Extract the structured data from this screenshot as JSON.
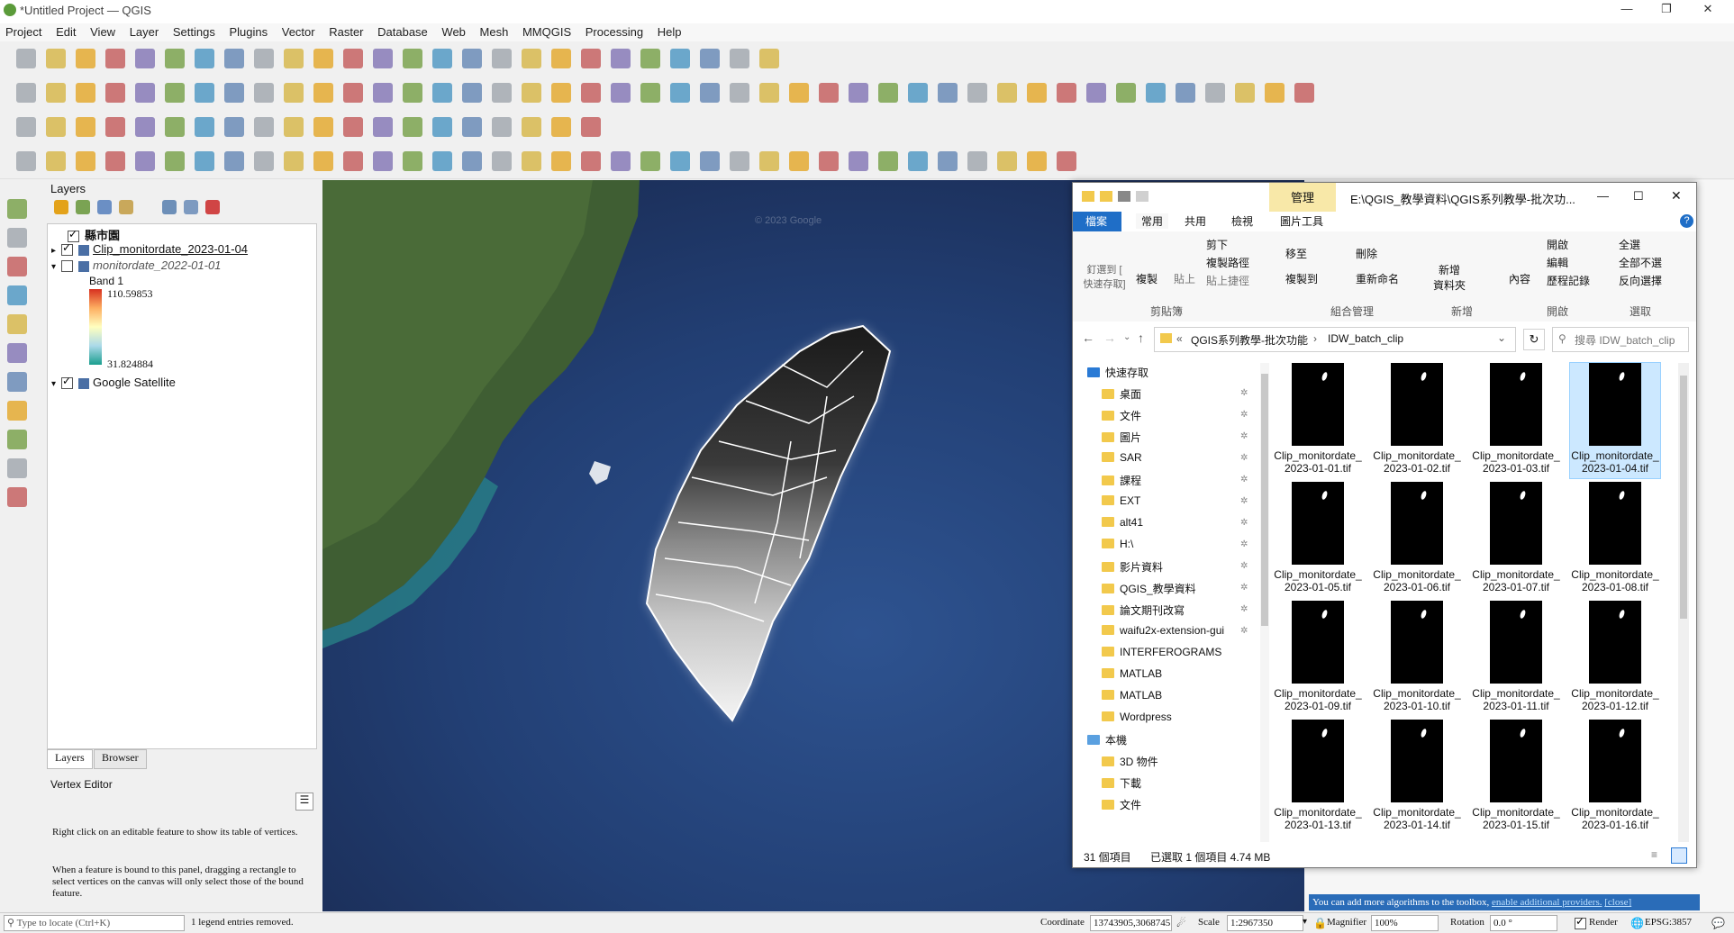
{
  "window": {
    "title": "*Untitled Project — QGIS"
  },
  "menu": [
    "Project",
    "Edit",
    "View",
    "Layer",
    "Settings",
    "Plugins",
    "Vector",
    "Raster",
    "Database",
    "Web",
    "Mesh",
    "MMQGIS",
    "Processing",
    "Help"
  ],
  "layers_panel": {
    "title": "Layers",
    "items": [
      {
        "label": "縣市園",
        "checked": true
      },
      {
        "label": "Clip_monitordate_2023-01-04",
        "checked": true
      },
      {
        "label": "monitordate_2022-01-01",
        "checked": false
      },
      {
        "label": "Band 1"
      },
      {
        "label": "110.59853"
      },
      {
        "label": "31.824884"
      },
      {
        "label": "Google Satellite",
        "checked": true
      }
    ],
    "tabs": [
      "Layers",
      "Browser"
    ]
  },
  "vertex_editor": {
    "title": "Vertex Editor",
    "text1": "Right click on an editable feature to show its table of vertices.",
    "text2": "When a feature is bound to this panel, dragging a rectangle to select vertices on the canvas will only select those of the bound feature."
  },
  "explorer": {
    "manage_tab": "管理",
    "path_title": "E:\\QGIS_教學資料\\QGIS系列教學-批次功...",
    "tabs": [
      "檔案",
      "常用",
      "共用",
      "檢視",
      "圖片工具"
    ],
    "ribbon": {
      "pin": "釘選到 [\n快速存取]",
      "copy": "複製",
      "paste": "貼上",
      "cut": "剪下",
      "copy_path": "複製路徑",
      "paste_shortcut": "貼上捷徑",
      "move_to": "移至",
      "copy_to": "複製到",
      "delete": "刪除",
      "rename": "重新命名",
      "new_folder": "新增\n資料夾",
      "properties": "內容",
      "open": "開啟",
      "edit": "編輯",
      "history": "歷程記錄",
      "select_all": "全選",
      "select_none": "全部不選",
      "invert": "反向選擇",
      "group_clipboard": "剪貼簿",
      "group_organize": "組合管理",
      "group_new": "新增",
      "group_open": "開啟",
      "group_select": "選取"
    },
    "address": {
      "crumb1": "QGIS系列教學-批次功能",
      "crumb2": "IDW_batch_clip",
      "search_placeholder": "搜尋 IDW_batch_clip"
    },
    "nav": [
      {
        "label": "快速存取",
        "pinned": false
      },
      {
        "label": "桌面",
        "pinned": true
      },
      {
        "label": "文件",
        "pinned": true
      },
      {
        "label": "圖片",
        "pinned": true
      },
      {
        "label": "SAR",
        "pinned": true
      },
      {
        "label": "課程",
        "pinned": true
      },
      {
        "label": "EXT",
        "pinned": true
      },
      {
        "label": "alt41",
        "pinned": true
      },
      {
        "label": "H:\\",
        "pinned": true
      },
      {
        "label": "影片資料",
        "pinned": true
      },
      {
        "label": "QGIS_教學資料",
        "pinned": true
      },
      {
        "label": "論文期刊改寫",
        "pinned": true
      },
      {
        "label": "waifu2x-extension-gui",
        "pinned": true
      },
      {
        "label": "INTERFEROGRAMS",
        "pinned": false
      },
      {
        "label": "MATLAB",
        "pinned": false
      },
      {
        "label": "MATLAB",
        "pinned": false
      },
      {
        "label": "Wordpress",
        "pinned": false
      },
      {
        "label": "本機",
        "pinned": false
      },
      {
        "label": "3D 物件",
        "pinned": false
      },
      {
        "label": "下載",
        "pinned": false
      },
      {
        "label": "文件",
        "pinned": false
      }
    ],
    "files": [
      "Clip_monitordate_2023-01-01.tif",
      "Clip_monitordate_2023-01-02.tif",
      "Clip_monitordate_2023-01-03.tif",
      "Clip_monitordate_2023-01-04.tif",
      "Clip_monitordate_2023-01-05.tif",
      "Clip_monitordate_2023-01-06.tif",
      "Clip_monitordate_2023-01-07.tif",
      "Clip_monitordate_2023-01-08.tif",
      "Clip_monitordate_2023-01-09.tif",
      "Clip_monitordate_2023-01-10.tif",
      "Clip_monitordate_2023-01-11.tif",
      "Clip_monitordate_2023-01-12.tif",
      "Clip_monitordate_2023-01-13.tif",
      "Clip_monitordate_2023-01-14.tif",
      "Clip_monitordate_2023-01-15.tif",
      "Clip_monitordate_2023-01-16.tif"
    ],
    "selected_index": 3,
    "status": {
      "count": "31 個項目",
      "selected": "已選取 1 個項目  4.74 MB"
    }
  },
  "info_bar": {
    "text": "You can add more algorithms to the toolbox, ",
    "link": "enable additional providers.",
    "close": "[close]"
  },
  "statusbar": {
    "locate_placeholder": "Type to locate (Ctrl+K)",
    "message": "1 legend entries removed.",
    "coord_label": "Coordinate",
    "coord_value": "13743905,3068745",
    "scale_label": "Scale",
    "scale_value": "1:2967350",
    "magnifier_label": "Magnifier",
    "magnifier_value": "100%",
    "rotation_label": "Rotation",
    "rotation_value": "0.0 °",
    "render_label": "Render",
    "crs": "EPSG:3857"
  },
  "map": {
    "watermark": "© 2023 Google"
  }
}
